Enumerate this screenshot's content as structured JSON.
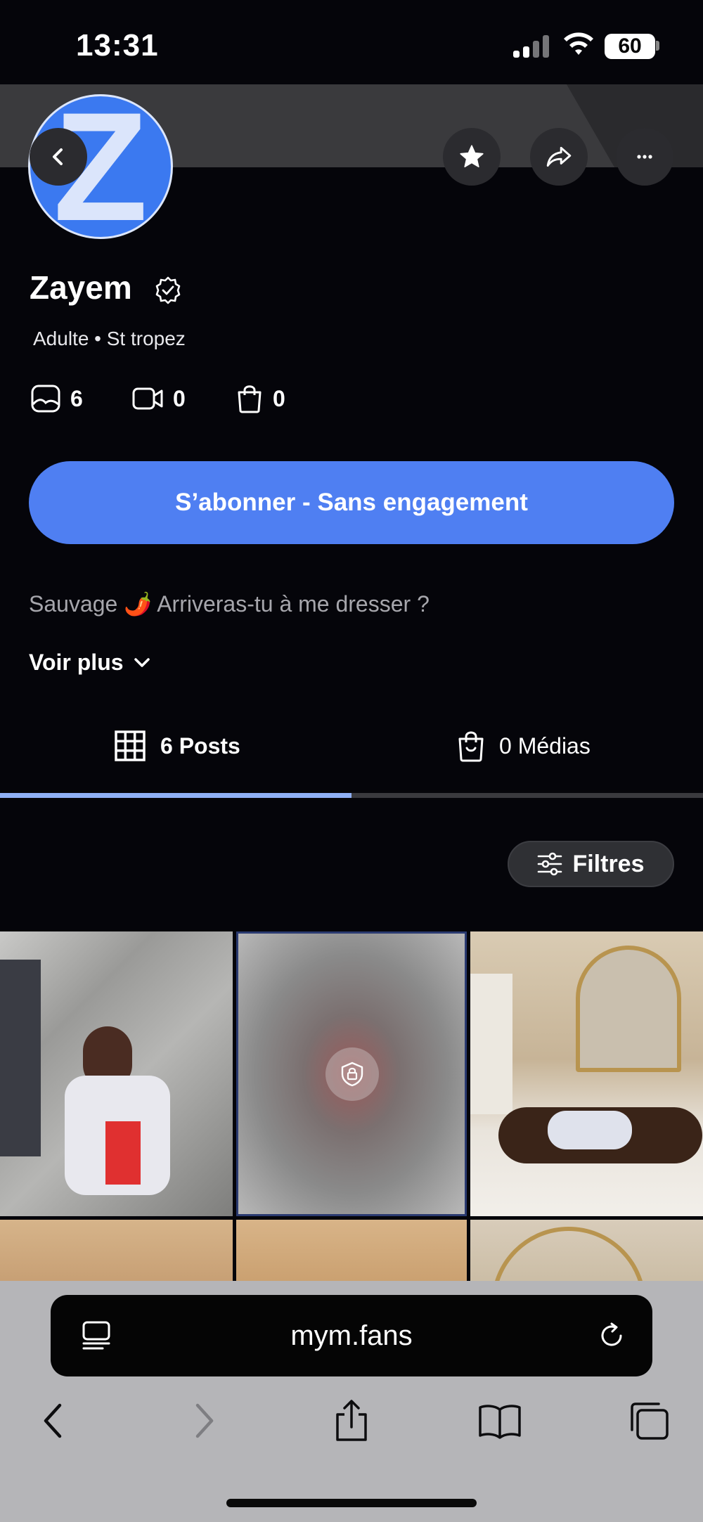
{
  "status_bar": {
    "time": "13:31",
    "battery": "60"
  },
  "profile": {
    "avatar_letter": "Z",
    "name": "Zayem",
    "subtitle": "Adulte • St tropez",
    "stats": {
      "photos": "6",
      "videos": "0",
      "purchases": "0"
    },
    "subscribe_label": "S’abonner - Sans engagement",
    "bio": "Sauvage 🌶️ Arriveras-tu à me dresser ?",
    "see_more_label": "Voir plus"
  },
  "tabs": [
    {
      "label": "6 Posts",
      "active": true
    },
    {
      "label": "0 Médias",
      "active": false
    }
  ],
  "filters_label": "Filtres",
  "safari": {
    "url": "mym.fans"
  },
  "colors": {
    "accent": "#4f7ff2",
    "background": "#05050a",
    "indicator": "#8fb0f5"
  }
}
